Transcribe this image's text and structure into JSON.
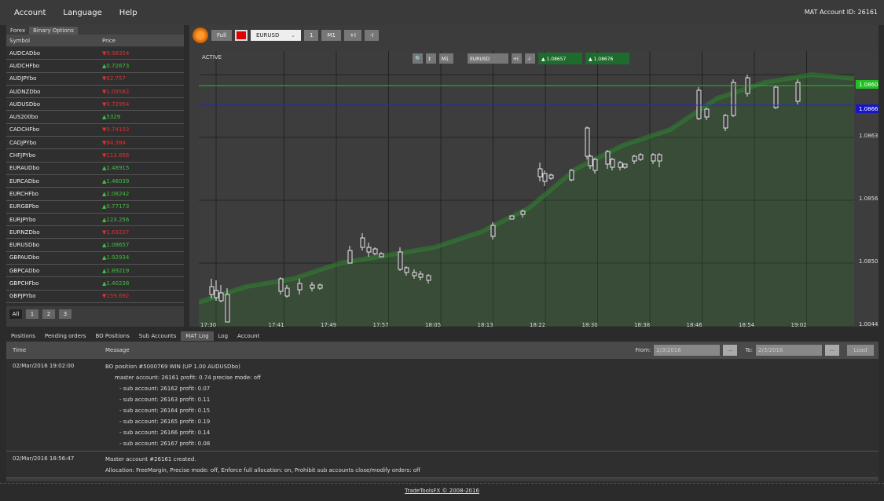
{
  "menu": {
    "items": [
      "Account",
      "Language",
      "Help"
    ],
    "account_id": "MAT Account ID: 26161"
  },
  "left": {
    "tabs": [
      "Forex",
      "Binary Options"
    ],
    "headers": {
      "symbol": "Symbol",
      "price": "Price"
    },
    "rows": [
      {
        "symbol": "AUDCADbo",
        "price": "▼0.98354",
        "dir": "dn"
      },
      {
        "symbol": "AUDCHFbo",
        "price": "▲0.72673",
        "dir": "up"
      },
      {
        "symbol": "AUDJPYbo",
        "price": "▼82.757",
        "dir": "dn"
      },
      {
        "symbol": "AUDNZDbo",
        "price": "▼1.09582",
        "dir": "dn"
      },
      {
        "symbol": "AUDUSDbo",
        "price": "▼0.72954",
        "dir": "dn"
      },
      {
        "symbol": "AUS200bo",
        "price": "▲5329",
        "dir": "up"
      },
      {
        "symbol": "CADCHFbo",
        "price": "▼0.74103",
        "dir": "dn"
      },
      {
        "symbol": "CADJPYbo",
        "price": "▼84.384",
        "dir": "dn"
      },
      {
        "symbol": "CHFJPYbo",
        "price": "▼113.856",
        "dir": "dn"
      },
      {
        "symbol": "EURAUDbo",
        "price": "▲1.48915",
        "dir": "up"
      },
      {
        "symbol": "EURCADbo",
        "price": "▲1.46039",
        "dir": "up"
      },
      {
        "symbol": "EURCHFbo",
        "price": "▲1.08242",
        "dir": "up"
      },
      {
        "symbol": "EURGBPbo",
        "price": "▲0.77173",
        "dir": "up"
      },
      {
        "symbol": "EURJPYbo",
        "price": "▲123.256",
        "dir": "up"
      },
      {
        "symbol": "EURNZDbo",
        "price": "▼1.63227",
        "dir": "dn"
      },
      {
        "symbol": "EURUSDbo",
        "price": "▲1.08657",
        "dir": "up"
      },
      {
        "symbol": "GBPAUDbo",
        "price": "▲1.92934",
        "dir": "up"
      },
      {
        "symbol": "GBPCADbo",
        "price": "▲1.89219",
        "dir": "up"
      },
      {
        "symbol": "GBPCHFbo",
        "price": "▲1.40238",
        "dir": "up"
      },
      {
        "symbol": "GBPJPYbo",
        "price": "▼159.692",
        "dir": "dn"
      },
      {
        "symbol": "GBPUSDbo",
        "price": "▼1.40126",
        "dir": "dn"
      }
    ],
    "pages": [
      "All",
      "1",
      "2",
      "3"
    ]
  },
  "toolbar": {
    "full": "Full",
    "symbol": "EURUSD",
    "qty": "1",
    "tf": "M1",
    "plus": "+I",
    "minus": "-I"
  },
  "chart": {
    "status": "ACTIVE",
    "overlay": {
      "symbol": "EURUSD",
      "tf": "M1",
      "plus": "+I",
      "minus": "-I",
      "bid": "▲ 1.08657",
      "ask": "▲ 1.08676"
    },
    "price_labels": [
      "1.0863",
      "1.0856",
      "1.0850",
      "1.0044"
    ],
    "green_level_label": "1.0860",
    "blue_level_label": "1.0866",
    "time_labels": [
      "17:30",
      "17:41",
      "17:49",
      "17:57",
      "18:05",
      "18:13",
      "18:22",
      "18:30",
      "18:38",
      "18:46",
      "18:54",
      "19:02"
    ],
    "colors": {
      "green_line": "#22c022",
      "blue_line": "#2020ff",
      "candle": "#e8e8e8",
      "area": "#2d7a2d"
    }
  },
  "bottom": {
    "tabs": [
      "Positions",
      "Pending orders",
      "BO Positions",
      "Sub Accounts",
      "MAT Log",
      "Log",
      "Account"
    ],
    "headers": {
      "time": "Time",
      "message": "Message"
    },
    "filter": {
      "from_label": "From:",
      "from_value": "2/3/2016",
      "to_label": "To:",
      "to_value": "2/3/2016",
      "dots": "...",
      "load": "Load"
    },
    "entries": [
      {
        "time": "02/Mar/2016 19:02:00",
        "lines": [
          "BO position #5000769 WIN (UP 1.00 AUDUSDbo)",
          "master account: 26161  profit: 0.74  precise mode: off",
          "- sub account: 26162  profit: 0.07",
          "- sub account: 26163  profit: 0.11",
          "- sub account: 26164  profit: 0.15",
          "- sub account: 26165  profit: 0.19",
          "- sub account: 26166  profit: 0.14",
          "- sub account: 26167  profit: 0.08"
        ]
      },
      {
        "time": "02/Mar/2016 18:56:47",
        "lines": [
          "Master account #26161 created.",
          "Allocation: FreeMargin,  Precise mode: off,  Enforce full allocation: on,  Prohibit sub accounts close/modify orders: off"
        ]
      }
    ]
  },
  "footer": "TradeToolsFX © 2008-2016"
}
